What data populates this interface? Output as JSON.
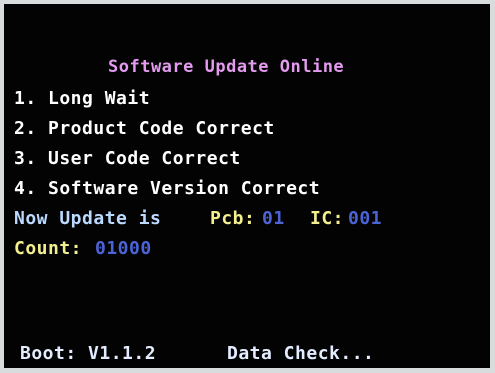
{
  "screen": {
    "title": "Software Update Online",
    "items": [
      "1. Long Wait",
      "2. Product Code Correct",
      "3. User Code Correct",
      "4. Software Version Correct"
    ],
    "status": {
      "update_label": "Now Update is",
      "pcb_label": "Pcb:",
      "pcb_value": "01",
      "ic_label": "IC:",
      "ic_value": "001",
      "count_label": "Count:",
      "count_value": "01000"
    },
    "footer": {
      "boot": "Boot: V1.1.2",
      "data_check": "Data Check..."
    }
  },
  "colors": {
    "background": "#030303",
    "title": "#e39bf0",
    "label_yellow": "#f3ef8e",
    "value_blue": "#4c63d6",
    "text_white": "#ffffff"
  }
}
